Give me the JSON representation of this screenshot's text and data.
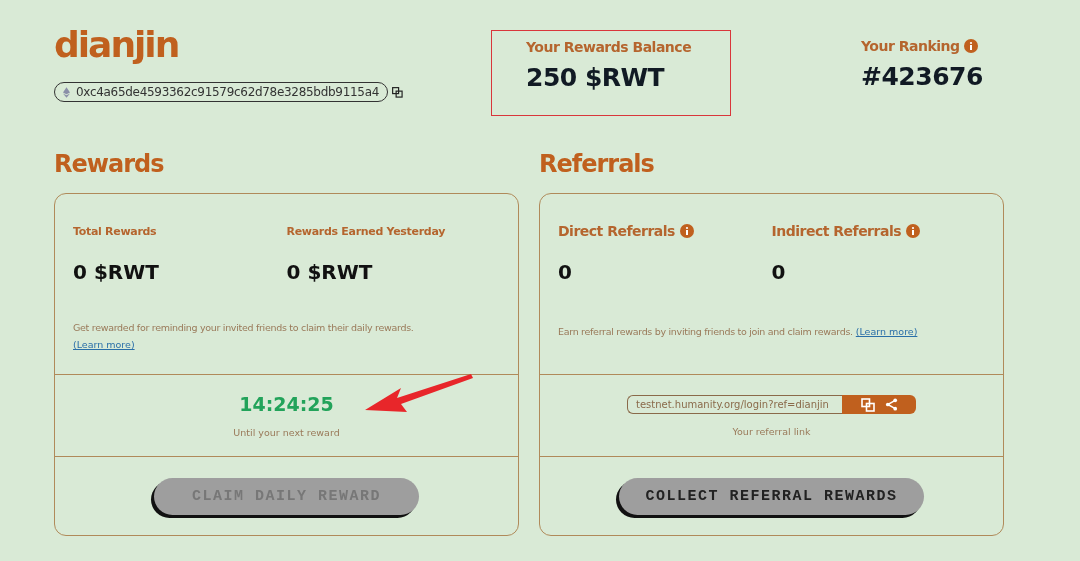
{
  "profile": {
    "username": "dianjin",
    "wallet_address": "0xc4a65de4593362c91579c62d78e3285bdb9115a4"
  },
  "balance": {
    "label": "Your Rewards Balance",
    "value": "250 $RWT"
  },
  "ranking": {
    "label": "Your Ranking",
    "value": "#423676",
    "info": true
  },
  "rewards": {
    "title": "Rewards",
    "stats": [
      {
        "label": "Total Rewards",
        "value": "0 $RWT"
      },
      {
        "label": "Rewards Earned Yesterday",
        "value": "0 $RWT"
      }
    ],
    "note": "Get rewarded for reminding your invited friends to claim their daily rewards.",
    "learn_more": "(Learn more)",
    "countdown": "14:24:25",
    "countdown_caption": "Until your next reward",
    "button": {
      "label": "CLAIM DAILY REWARD",
      "disabled": true
    }
  },
  "referrals": {
    "title": "Referrals",
    "stats": [
      {
        "label": "Direct Referrals",
        "value": "0",
        "info": true
      },
      {
        "label": "Indirect Referrals",
        "value": "0",
        "info": true
      }
    ],
    "note": "Earn referral rewards by inviting friends to join and claim rewards.",
    "learn_more": "(Learn more)",
    "link": "testnet.humanity.org/login?ref=dianjin",
    "link_caption": "Your referral link",
    "button": {
      "label": "COLLECT REFERRAL REWARDS",
      "disabled": false
    }
  }
}
